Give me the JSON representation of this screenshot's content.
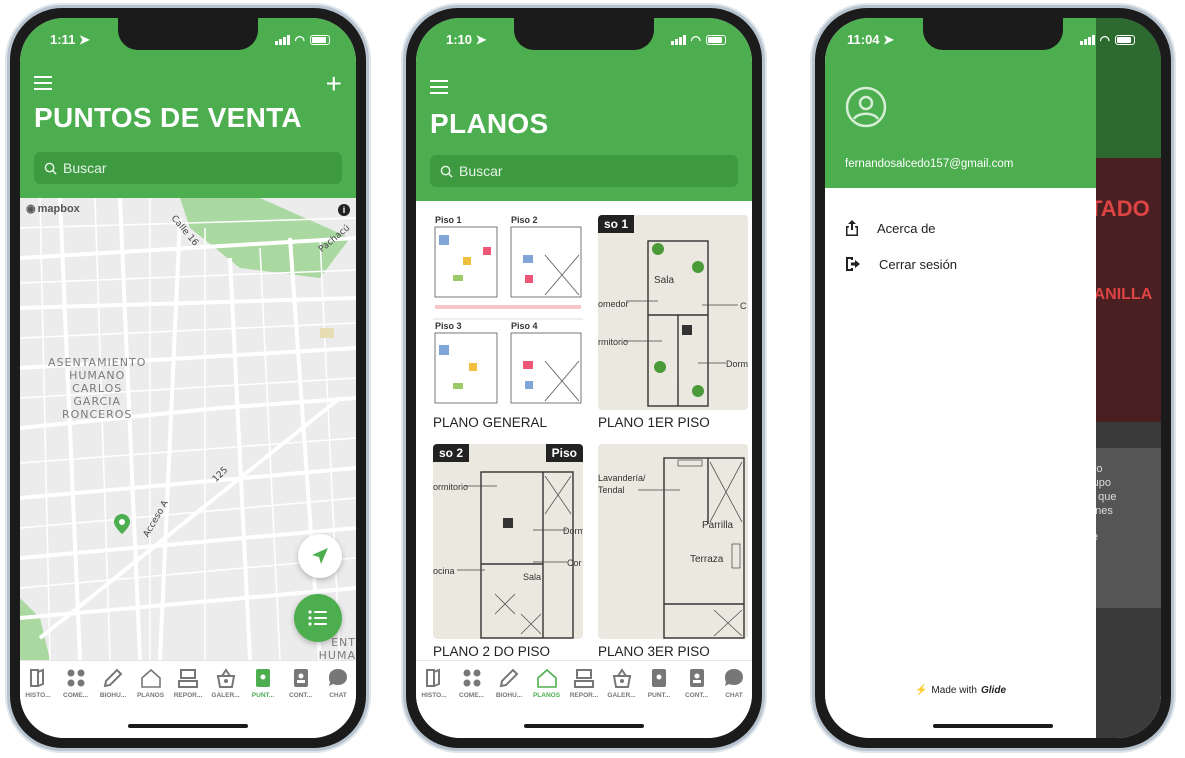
{
  "colors": {
    "primary": "#4cae4f",
    "primary_dark": "#3d9a41"
  },
  "screen1": {
    "time": "1:11",
    "title": "PUNTOS DE VENTA",
    "search_placeholder": "Buscar",
    "map": {
      "attribution": "mapbox",
      "area_label": "ASENTAMIENTO\nHUMANO\nCARLOS\nGARCIA\nRONCEROS",
      "area_label_right": "ENT\nHUMA",
      "streets": [
        "Calle 16",
        "Acceso A",
        "125",
        "Pachacú"
      ]
    },
    "active_tab": "PUNT..."
  },
  "screen2": {
    "time": "1:10",
    "title": "PLANOS",
    "search_placeholder": "Buscar",
    "cards": [
      {
        "caption": "PLANO GENERAL",
        "labels": [
          "Piso 1",
          "Piso 2",
          "Piso 3",
          "Piso 4"
        ]
      },
      {
        "caption": "PLANO 1ER PISO",
        "tag": "so 1",
        "labels": [
          "Sala",
          "omedor",
          "rmitorio",
          "Dorm",
          "C"
        ]
      },
      {
        "caption": "PLANO 2 DO PISO",
        "tag": "so 2",
        "tag2": "Piso",
        "labels": [
          "ormitorio",
          "Dorm",
          "Cor",
          "Sala",
          "ocina"
        ]
      },
      {
        "caption": "PLANO 3ER PISO",
        "labels": [
          "Lavandería/ Tendal",
          "Parrilla",
          "Terraza"
        ]
      }
    ],
    "active_tab": "PLANOS"
  },
  "screen3": {
    "time": "11:04",
    "email": "fernandosalcedo157@gmail.com",
    "menu": [
      {
        "label": "Acerca de",
        "icon": "share-icon"
      },
      {
        "label": "Cerrar sesión",
        "icon": "logout-icon"
      }
    ],
    "footer_prefix": "Made with",
    "footer_brand": "Glide",
    "background_fragments": [
      "TADO",
      "TANILLA",
      "rro",
      "rupo",
      "a que",
      "ones",
      "te"
    ]
  },
  "tabs": [
    {
      "label": "HISTO...",
      "icon": "book-icon"
    },
    {
      "label": "COME...",
      "icon": "dots-icon"
    },
    {
      "label": "BIOHU...",
      "icon": "pencil-icon"
    },
    {
      "label": "PLANOS",
      "icon": "house-icon"
    },
    {
      "label": "REPOR...",
      "icon": "cashier-icon"
    },
    {
      "label": "GALER...",
      "icon": "basket-icon"
    },
    {
      "label": "PUNT...",
      "icon": "location-card-icon"
    },
    {
      "label": "CONT...",
      "icon": "contact-card-icon"
    },
    {
      "label": "CHAT",
      "icon": "chat-icon"
    }
  ]
}
